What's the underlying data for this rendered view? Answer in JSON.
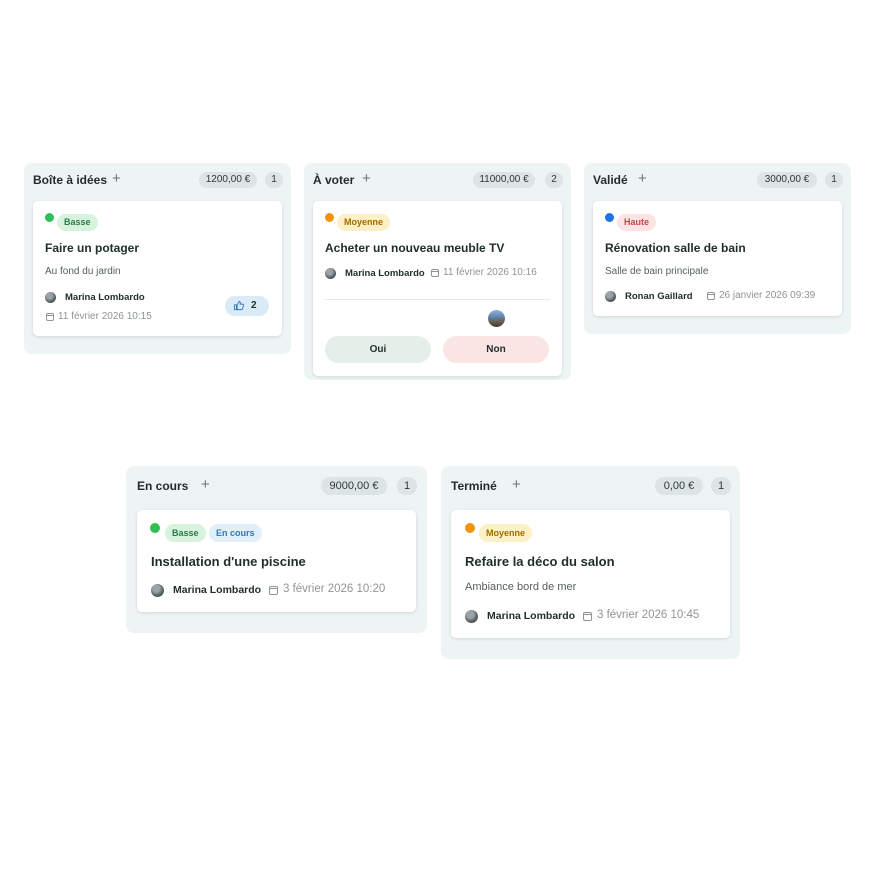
{
  "columns": {
    "ideas": {
      "title": "Boîte à idées",
      "amount": "1200,00 €",
      "count": "1",
      "card": {
        "priority": "Basse",
        "title": "Faire un potager",
        "description": "Au fond du jardin",
        "author": "Marina Lombardo",
        "date": "11 février 2026 10:15",
        "likes": "2"
      }
    },
    "vote": {
      "title": "À voter",
      "amount": "11000,00 €",
      "count": "2",
      "card": {
        "priority": "Moyenne",
        "title": "Acheter un nouveau meuble TV",
        "author": "Marina Lombardo",
        "date": "11 février 2026 10:16",
        "yes_label": "Oui",
        "no_label": "Non"
      }
    },
    "validated": {
      "title": "Validé",
      "amount": "3000,00 €",
      "count": "1",
      "card": {
        "priority": "Haute",
        "title": "Rénovation salle de bain",
        "description": "Salle de bain principale",
        "author": "Ronan Gaillard",
        "date": "26 janvier 2026 09:39"
      }
    },
    "in_progress": {
      "title": "En cours",
      "amount": "9000,00 €",
      "count": "1",
      "card": {
        "priority": "Basse",
        "status": "En cours",
        "title": "Installation d'une piscine",
        "author": "Marina Lombardo",
        "date": "3 février 2026 10:20"
      }
    },
    "done": {
      "title": "Terminé",
      "amount": "0,00 €",
      "count": "1",
      "card": {
        "priority": "Moyenne",
        "title": "Refaire la déco du salon",
        "description": "Ambiance bord de mer",
        "author": "Marina Lombardo",
        "date": "3 février 2026 10:45"
      }
    }
  },
  "colors": {
    "priority_low": "#2fbf56",
    "priority_mid": "#f5930f",
    "priority_high": "#1e73e8",
    "vote_yes": "#e4efe9",
    "vote_no": "#fbe4e4"
  }
}
